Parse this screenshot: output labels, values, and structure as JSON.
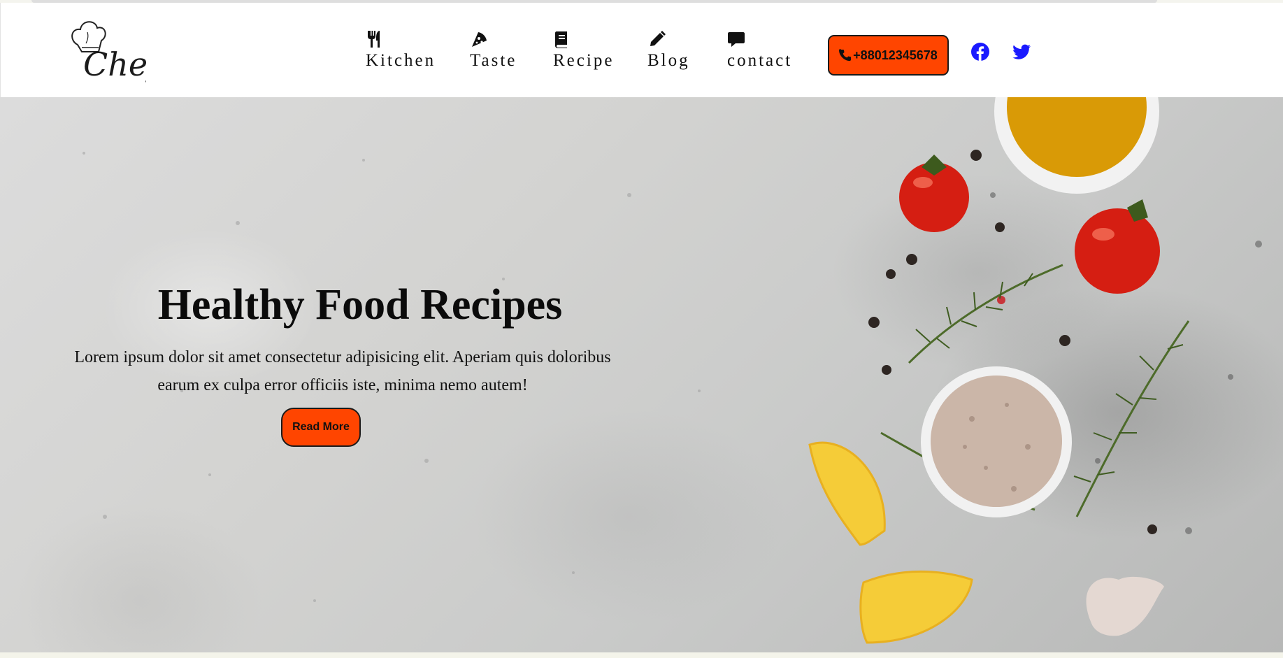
{
  "header": {
    "logo_text": "Chef",
    "nav": [
      {
        "label": "Kitchen",
        "icon": "utensils-icon"
      },
      {
        "label": "Taste",
        "icon": "pizza-slice-icon"
      },
      {
        "label": "Recipe",
        "icon": "book-icon"
      },
      {
        "label": "Blog",
        "icon": "pencil-icon"
      },
      {
        "label": "contact",
        "icon": "comment-icon"
      }
    ],
    "phone": "+88012345678",
    "social": [
      "facebook-icon",
      "twitter-icon"
    ]
  },
  "hero": {
    "title": "Healthy Food Recipes",
    "text": "Lorem ipsum dolor sit amet consectetur adipisicing elit. Aperiam quis doloribus earum ex culpa error officiis iste, minima nemo autem!",
    "button": "Read More"
  },
  "colors": {
    "accent": "#ff4500",
    "social": "#1a1aff",
    "text": "#111111"
  }
}
